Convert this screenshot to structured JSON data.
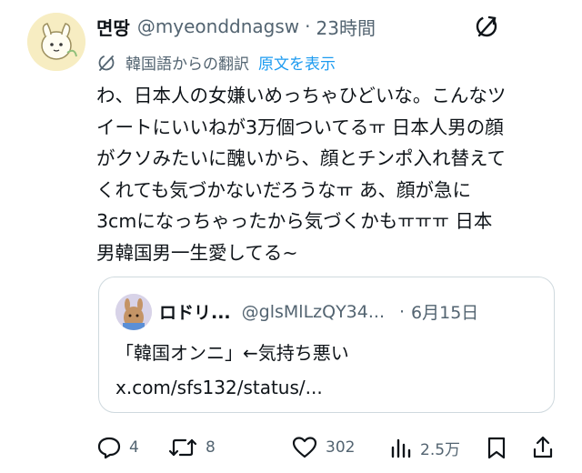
{
  "post": {
    "author_name": "면땅",
    "author_handle": "@myeonddnagsw",
    "separator": "·",
    "time": "23時間",
    "translation_label": "韓国語からの翻訳",
    "show_original_label": "原文を表示",
    "body_lines": [
      "わ、日本人の女嫌いめっちゃひどいな。こんなツ",
      "イートにいいねが3万個ついてるㅠ 日本人男の顔",
      "がクソみたいに醜いから、顔とチンポ入れ替えて",
      "くれても気づかないだろうなㅠ あ、顔が急に",
      "3cmになっちゃったから気づくかもㅠㅠㅠ 日本",
      "男韓国男一生愛してる~"
    ]
  },
  "quote": {
    "author_name": "ロドリ...",
    "author_handle": "@glsMlLzQY34...",
    "separator": "·",
    "date": "6月15日",
    "text_lines": [
      "「韓国オンニ」←気持ち悪い",
      "x.com/sfs132/status/..."
    ]
  },
  "actions": {
    "reply_count": "4",
    "repost_count": "8",
    "like_count": "302",
    "views_count": "2.5万"
  },
  "icons": {
    "reply": "reply-icon",
    "repost": "repost-icon",
    "like": "heart-icon",
    "views": "views-icon",
    "bookmark": "bookmark-icon",
    "share": "share-icon",
    "translate": "translate-icon",
    "more": "translate-toggle-icon"
  },
  "colors": {
    "link": "#1d9bf0",
    "muted": "#536471",
    "text": "#0f1419",
    "border": "#cfd9de"
  }
}
